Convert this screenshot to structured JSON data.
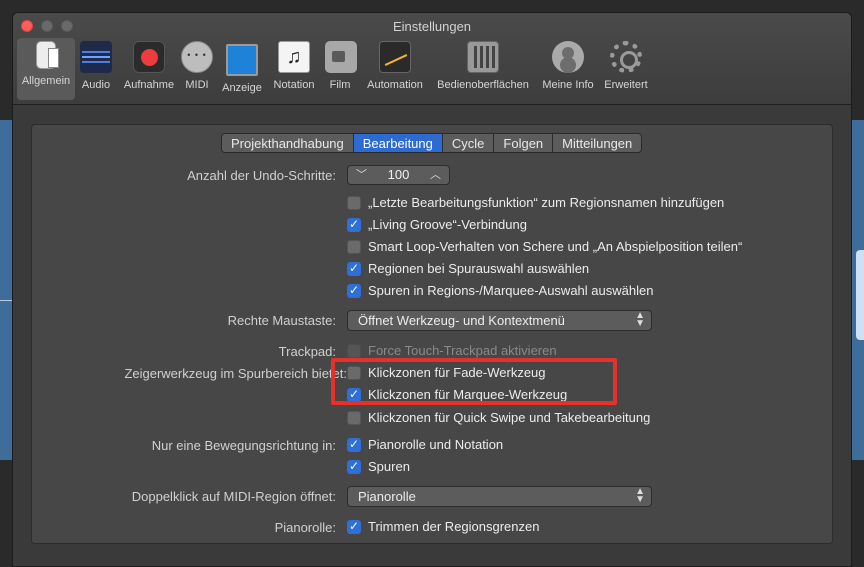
{
  "window": {
    "title": "Einstellungen"
  },
  "toolbar": {
    "items": [
      {
        "label": "Allgemein",
        "icon": "general-icon",
        "active": true
      },
      {
        "label": "Audio",
        "icon": "audio-waveform-icon"
      },
      {
        "label": "Aufnahme",
        "icon": "record-icon"
      },
      {
        "label": "MIDI",
        "icon": "midi-connector-icon"
      },
      {
        "label": "Anzeige",
        "icon": "display-icon"
      },
      {
        "label": "Notation",
        "icon": "music-note-icon"
      },
      {
        "label": "Film",
        "icon": "film-camera-icon"
      },
      {
        "label": "Automation",
        "icon": "automation-curve-icon"
      },
      {
        "label": "Bedienoberflächen",
        "icon": "control-surface-icon"
      },
      {
        "label": "Meine Info",
        "icon": "user-account-icon"
      },
      {
        "label": "Erweitert",
        "icon": "gear-icon"
      }
    ]
  },
  "tabs": [
    "Projekthandhabung",
    "Bearbeitung",
    "Cycle",
    "Folgen",
    "Mitteilungen"
  ],
  "active_tab": "Bearbeitung",
  "settings": {
    "undo_label": "Anzahl der Undo-Schritte:",
    "undo_value": "100",
    "options": [
      "„Letzte Bearbeitungsfunktion“ zum Regionsnamen hinzufügen",
      "„Living Groove“-Verbindung",
      "Smart Loop-Verhalten von Schere und „An Abspielposition teilen“",
      "Regionen bei Spurauswahl auswählen",
      "Spuren in Regions-/Marquee-Auswahl auswählen"
    ],
    "right_mouse_label": "Rechte Maustaste:",
    "right_mouse_value": "Öffnet Werkzeug- und Kontextmenü",
    "trackpad_label": "Trackpad:",
    "trackpad_option": "Force Touch-Trackpad aktivieren",
    "pointer_label": "Zeigerwerkzeug im Spurbereich bietet:",
    "pointer_options": [
      "Klickzonen für Fade-Werkzeug",
      "Klickzonen für Marquee-Werkzeug",
      "Klickzonen für Quick Swipe und Takebearbeitung"
    ],
    "direction_label": "Nur eine Bewegungsrichtung in:",
    "direction_options": [
      "Pianorolle und Notation",
      "Spuren"
    ],
    "dblclick_label": "Doppelklick auf MIDI-Region öffnet:",
    "dblclick_value": "Pianorolle",
    "pianoroll_label": "Pianorolle:",
    "pianoroll_option": "Trimmen der Regionsgrenzen"
  },
  "colors": {
    "accent": "#2d6bd0",
    "highlight": "#e8302a",
    "close": "#ff5f57"
  }
}
